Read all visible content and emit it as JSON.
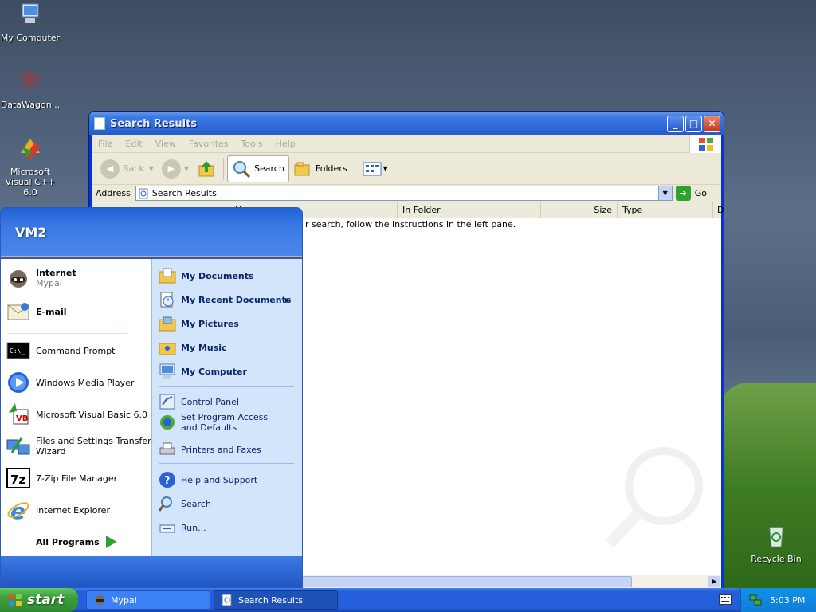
{
  "desktop": {
    "icons": [
      {
        "label": "My Computer",
        "icon": "computer-icon"
      },
      {
        "label": "DataWagon...",
        "icon": "datawagon-icon"
      },
      {
        "label": "Microsoft Visual C++ 6.0",
        "icon": "visual-cpp-icon"
      },
      {
        "label": "Recycle Bin",
        "icon": "recycle-bin-icon"
      }
    ]
  },
  "window": {
    "title": "Search Results",
    "menu": [
      "File",
      "Edit",
      "View",
      "Favorites",
      "Tools",
      "Help"
    ],
    "toolbar": {
      "back": "Back",
      "search": "Search",
      "folders": "Folders"
    },
    "address_label": "Address",
    "address_value": "Search Results",
    "go_label": "Go",
    "columns": [
      "N",
      "In Folder",
      "Size",
      "Type",
      "D"
    ],
    "message": "r search, follow the instructions in the left pane."
  },
  "start_menu": {
    "user": "VM2",
    "pinned": [
      {
        "label": "Internet",
        "sub": "Mypal",
        "icon": "mypal-icon"
      },
      {
        "label": "E-mail",
        "sub": "",
        "icon": "email-icon"
      }
    ],
    "recent": [
      {
        "label": "Command Prompt",
        "icon": "cmd-icon"
      },
      {
        "label": "Windows Media Player",
        "icon": "media-player-icon"
      },
      {
        "label": "Microsoft Visual Basic 6.0",
        "icon": "visual-basic-icon"
      },
      {
        "label": "Files and Settings Transfer Wizard",
        "icon": "transfer-wizard-icon"
      },
      {
        "label": "7-Zip File Manager",
        "icon": "7zip-icon"
      },
      {
        "label": "Internet Explorer",
        "icon": "ie-icon"
      }
    ],
    "all_programs": "All Programs",
    "places": [
      {
        "label": "My Documents",
        "icon": "documents-folder-icon"
      },
      {
        "label": "My Recent Documents",
        "icon": "recent-docs-icon"
      },
      {
        "label": "My Pictures",
        "icon": "pictures-folder-icon"
      },
      {
        "label": "My Music",
        "icon": "music-folder-icon"
      },
      {
        "label": "My Computer",
        "icon": "computer-icon"
      }
    ],
    "system": [
      {
        "label": "Control Panel",
        "icon": "control-panel-icon"
      },
      {
        "label": "Set Program Access and Defaults",
        "icon": "program-access-icon"
      },
      {
        "label": "Printers and Faxes",
        "icon": "printer-icon"
      }
    ],
    "tools": [
      {
        "label": "Help and Support",
        "icon": "help-icon"
      },
      {
        "label": "Search",
        "icon": "search-icon"
      },
      {
        "label": "Run...",
        "icon": "run-icon"
      }
    ]
  },
  "taskbar": {
    "start": "start",
    "tasks": [
      {
        "label": "Mypal",
        "icon": "mypal-icon"
      },
      {
        "label": "Search Results",
        "icon": "search-results-icon"
      }
    ],
    "clock": "5:03 PM"
  }
}
